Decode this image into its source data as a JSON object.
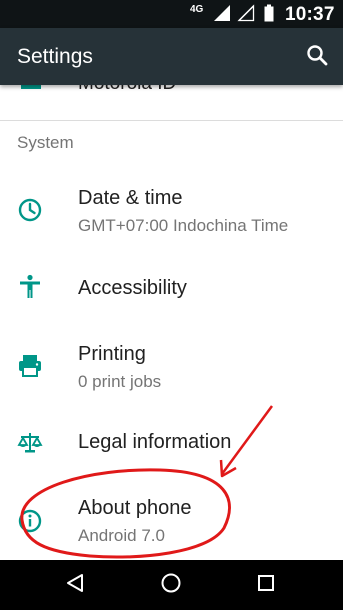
{
  "status_bar": {
    "network": "4G",
    "time": "10:37"
  },
  "app_bar": {
    "title": "Settings",
    "search_icon": "search-icon"
  },
  "partial_row": {
    "label": "Motorola ID",
    "icon": "account-icon"
  },
  "section": {
    "header": "System"
  },
  "items": [
    {
      "title": "Date & time",
      "subtitle": "GMT+07:00 Indochina Time",
      "icon": "clock-icon"
    },
    {
      "title": "Accessibility",
      "subtitle": "",
      "icon": "accessibility-icon"
    },
    {
      "title": "Printing",
      "subtitle": "0 print jobs",
      "icon": "printer-icon"
    },
    {
      "title": "Legal information",
      "subtitle": "",
      "icon": "scale-icon"
    },
    {
      "title": "About phone",
      "subtitle": "Android 7.0",
      "icon": "info-icon"
    }
  ],
  "nav": {
    "back": "back-icon",
    "home": "home-icon",
    "recents": "recents-icon"
  },
  "colors": {
    "status_bar": "#0f1416",
    "app_bar": "#263238",
    "accent": "#009688",
    "annotation": "#e01919"
  }
}
